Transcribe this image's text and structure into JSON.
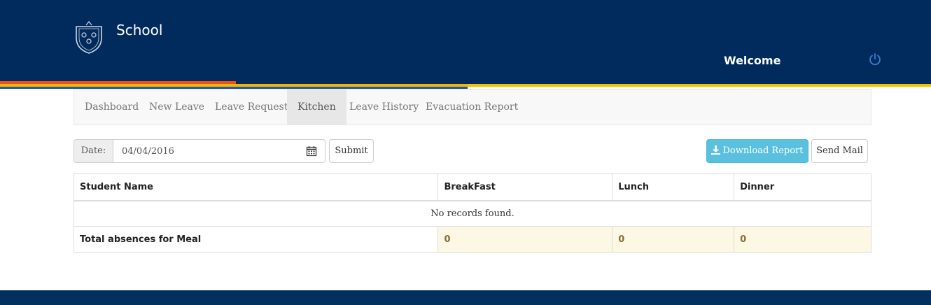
{
  "header": {
    "brand": "School",
    "welcome": "Welcome",
    "logo_icon": "school-crest-icon",
    "power_icon": "power-icon"
  },
  "colors": {
    "header_bg": "#002b5c",
    "stripe_orange": "#e8501e",
    "stripe_yellow": "#f4b400",
    "stripe_blue": "#1f5ba8",
    "accent_info": "#5bc0de",
    "total_row_bg": "#fcf8e3"
  },
  "nav": {
    "items": [
      {
        "label": "Dashboard"
      },
      {
        "label": "New Leave"
      },
      {
        "label": "Leave Requests"
      },
      {
        "label": "Kitchen",
        "active": true
      },
      {
        "label": "Leave History"
      },
      {
        "label": "Evacuation Report"
      }
    ]
  },
  "filter": {
    "date_label": "Date:",
    "date_value": "04/04/2016",
    "calendar_icon": "calendar-icon",
    "submit_label": "Submit"
  },
  "actions": {
    "download_label": "Download Report",
    "download_icon": "download-icon",
    "send_mail_label": "Send Mail"
  },
  "table": {
    "columns": [
      "Student Name",
      "BreakFast",
      "Lunch",
      "Dinner"
    ],
    "empty_message": "No records found.",
    "total": {
      "label": "Total absences for Meal",
      "breakfast": "0",
      "lunch": "0",
      "dinner": "0"
    }
  }
}
